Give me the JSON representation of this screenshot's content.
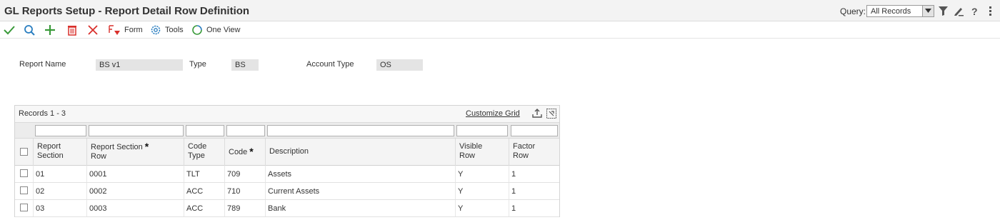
{
  "header": {
    "title": "GL Reports Setup - Report Detail Row Definition",
    "query_label": "Query:",
    "query_value": "All Records"
  },
  "toolbar": {
    "form_label": "Form",
    "tools_label": "Tools",
    "oneview_label": "One View"
  },
  "form": {
    "report_name_label": "Report Name",
    "report_name_value": "BS v1",
    "type_label": "Type",
    "type_value": "BS",
    "account_type_label": "Account Type",
    "account_type_value": "OS"
  },
  "grid": {
    "records_label": "Records 1 - 3",
    "customize_label": "Customize Grid",
    "columns": [
      {
        "line1": "Report",
        "line2": "Section",
        "required": false
      },
      {
        "line1": "Report Section",
        "line2": "Row",
        "required": true
      },
      {
        "line1": "Code",
        "line2": "Type",
        "required": false
      },
      {
        "line1": "Code",
        "line2": "",
        "required": true
      },
      {
        "line1": "Description",
        "line2": "",
        "required": false
      },
      {
        "line1": "Visible",
        "line2": "Row",
        "required": false
      },
      {
        "line1": "Factor",
        "line2": "Row",
        "required": false
      }
    ],
    "rows": [
      {
        "section": "01",
        "row": "0001",
        "code_type": "TLT",
        "code": "709",
        "description": "Assets",
        "visible": "Y",
        "factor": "1"
      },
      {
        "section": "02",
        "row": "0002",
        "code_type": "ACC",
        "code": "710",
        "description": "Current Assets",
        "visible": "Y",
        "factor": "1"
      },
      {
        "section": "03",
        "row": "0003",
        "code_type": "ACC",
        "code": "789",
        "description": "Bank",
        "visible": "Y",
        "factor": "1"
      }
    ]
  },
  "colors": {
    "accept_green": "#3a9a3a",
    "find_blue": "#2a7ec0",
    "add_green": "#3a9a3a",
    "delete_red": "#d9302c",
    "cancel_red": "#d9302c"
  },
  "icons": {
    "header": [
      "filter-icon",
      "personalize-icon",
      "help-icon",
      "more-icon"
    ],
    "toolbar": [
      "checkmark-icon",
      "search-icon",
      "plus-icon",
      "trash-icon",
      "close-icon",
      "form-icon",
      "gear-icon",
      "oneview-icon"
    ],
    "grid": [
      "export-icon",
      "maximize-icon"
    ]
  }
}
